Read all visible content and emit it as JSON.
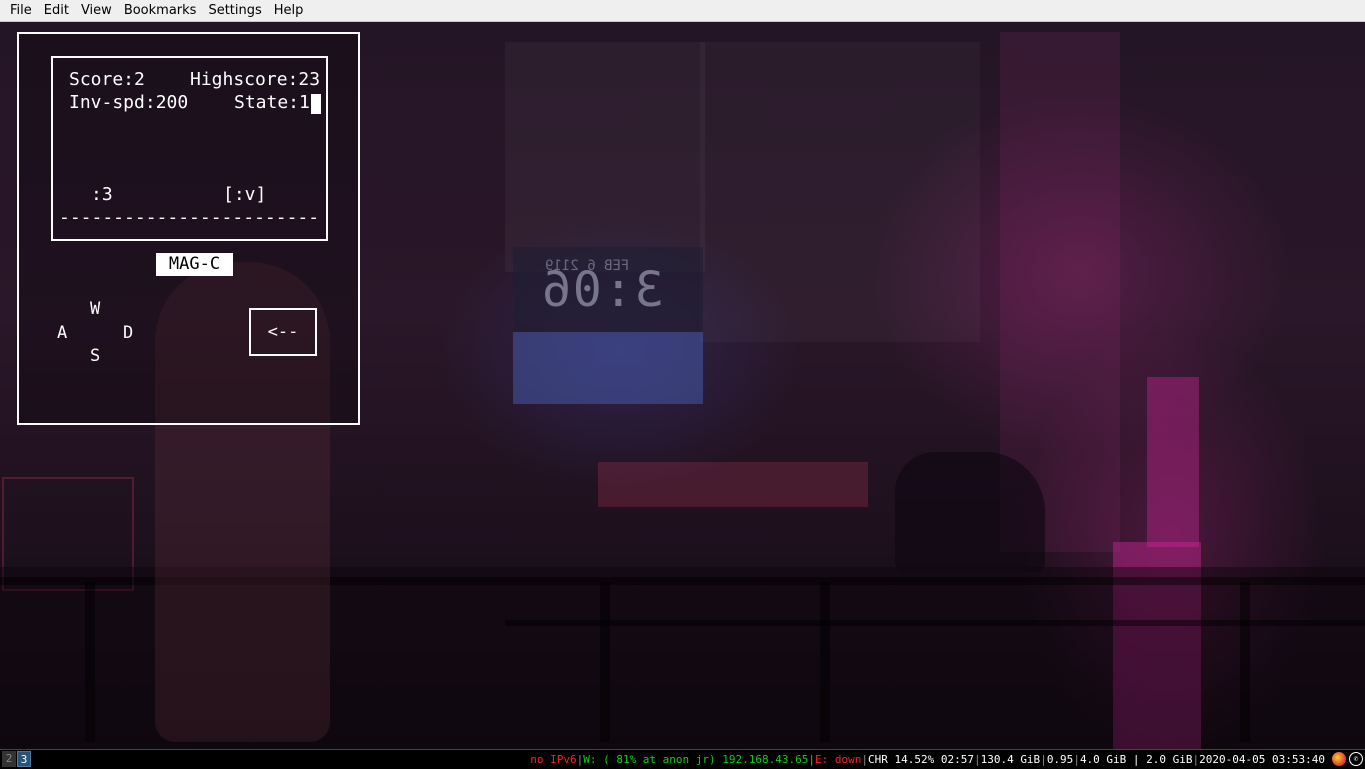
{
  "menubar": {
    "items": [
      "File",
      "Edit",
      "View",
      "Bookmarks",
      "Settings",
      "Help"
    ]
  },
  "game": {
    "score_label": "Score:2",
    "highscore_label": "Highscore:23",
    "inv_spd_label": "Inv-spd:200",
    "state_label": "State:1",
    "face_left": ":3",
    "face_right": "[:v]",
    "dash_line": "------------------------",
    "mode_button": "MAG-C",
    "keys": {
      "up": "W",
      "left": "A",
      "right": "D",
      "down": "S"
    },
    "back_button": "<--"
  },
  "wallpaper": {
    "clock_digits": "3:06",
    "clock_date": "FEB 6  2119"
  },
  "statusbar": {
    "workspaces": [
      "2",
      "3"
    ],
    "active_workspace": "3",
    "ipv6": "no IPv6",
    "wifi": "W: ( 81% at anon jr) 192.168.43.65",
    "ethernet": "E: down",
    "battery": "CHR 14.52% 02:57",
    "disk": "130.4 GiB",
    "load": "0.95",
    "memory": "4.0 GiB | 2.0 GiB",
    "datetime": "2020-04-05 03:53:40",
    "tray_icons": [
      "firefox-icon",
      "whatsapp-icon"
    ],
    "colors": {
      "bad": "#ff2020",
      "good": "#10d010",
      "active_ws": "#285577"
    }
  }
}
